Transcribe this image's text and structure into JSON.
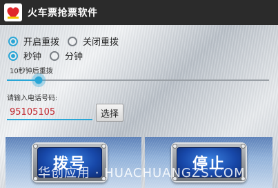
{
  "app": {
    "title": "火车票抢票软件"
  },
  "redial": {
    "options": [
      {
        "label": "开启重拨",
        "checked": true
      },
      {
        "label": "关闭重拨",
        "checked": false
      }
    ]
  },
  "unit": {
    "options": [
      {
        "label": "秒钟",
        "checked": true
      },
      {
        "label": "分钟",
        "checked": false
      }
    ]
  },
  "slider": {
    "label": "10秒钟后重拨",
    "value_fraction": 0.12
  },
  "phone": {
    "label": "请输入电话号码:",
    "value": "95105105",
    "select_label": "选择"
  },
  "actions": {
    "dial_label": "拨号",
    "stop_label": "停止"
  },
  "watermark": "华创应用 · HUACHUANGZS.COM",
  "colors": {
    "accent": "#2aa6d6",
    "phone_text": "#c0242b",
    "titlebar": "#2b2b2b"
  }
}
